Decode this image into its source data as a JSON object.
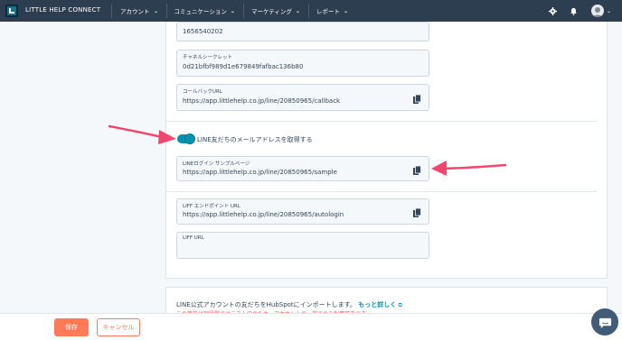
{
  "nav": {
    "brand": "LITTLE HELP CONNECT",
    "items": [
      {
        "label": "アカウント"
      },
      {
        "label": "コミュニケーション"
      },
      {
        "label": "マーケティング"
      },
      {
        "label": "レポート"
      }
    ],
    "icons": [
      "gear-icon",
      "bell-icon",
      "avatar"
    ]
  },
  "fields": {
    "channel_id": {
      "value": "1656540202"
    },
    "channel_secret": {
      "label": "チャネルシークレット",
      "value": "0d21bfbf989d1e679849fafbac136b80"
    },
    "callback_url": {
      "label": "コールバックURL",
      "value": "https://app.littlehelp.co.jp/line/20850965/callback"
    },
    "login_sample": {
      "label": "LINEログイン サンプルページ",
      "value": "https://app.littlehelp.co.jp/line/20850965/sample"
    },
    "liff_endpoint": {
      "label": "LIFF エンドポイント URL",
      "value": "https://app.littlehelp.co.jp/line/20850965/autologin"
    },
    "liff_url": {
      "label": "LIFF URL",
      "value": ""
    }
  },
  "toggle": {
    "label": "LINE友だちのメールアドレスを取得する",
    "on": true
  },
  "import_card": {
    "text": "LINE公式アカウントの友だちをHubSpotにインポートします。",
    "link": "もっと詳しく",
    "warning": "この機能は現段階ではテスト中のため、アカウントの一部でのみ利用可能です"
  },
  "footer": {
    "save": "保存",
    "cancel": "キャンセル"
  },
  "colors": {
    "nav_bg": "#2d3e50",
    "accent": "#0091ae",
    "save": "#ff7a59",
    "arrow": "#f0476f"
  }
}
